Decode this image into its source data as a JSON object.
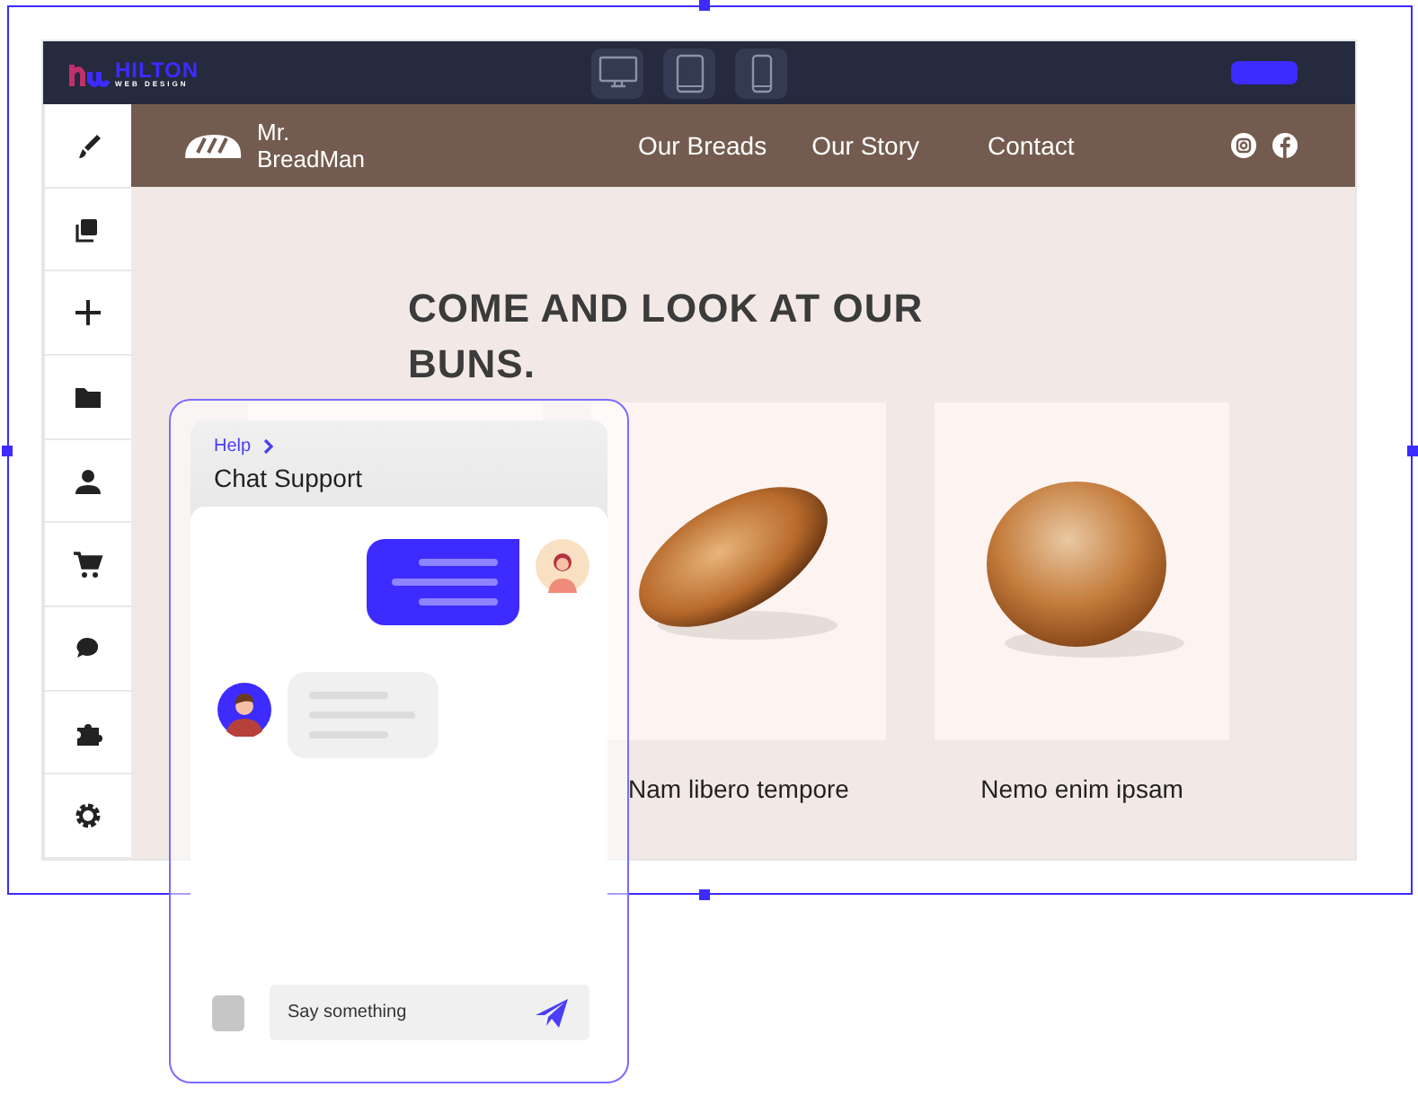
{
  "editor": {
    "logo": {
      "name": "HILTON",
      "tagline": "WEB DESIGN"
    },
    "devices": [
      {
        "kind": "desktop"
      },
      {
        "kind": "tablet"
      },
      {
        "kind": "phone"
      }
    ],
    "sidebar": {
      "items": [
        {
          "kind": "brush"
        },
        {
          "kind": "copy"
        },
        {
          "kind": "plus"
        },
        {
          "kind": "folder"
        },
        {
          "kind": "person"
        },
        {
          "kind": "cart"
        },
        {
          "kind": "chat"
        },
        {
          "kind": "puzzle"
        },
        {
          "kind": "gear"
        }
      ]
    }
  },
  "site": {
    "brand": "Mr. BreadMan",
    "nav": [
      "Our Breads",
      "Our Story",
      "Contact"
    ],
    "heading": "COME AND LOOK AT OUR BUNS.",
    "products": [
      {
        "kind": "blank"
      },
      {
        "kind": "loaf",
        "label": "Nam libero tempore"
      },
      {
        "kind": "round",
        "label": "Nemo enim ipsam"
      }
    ]
  },
  "chat": {
    "breadcrumb": "Help",
    "title": "Chat Support",
    "messages": [
      {
        "kind": "outgoing"
      },
      {
        "kind": "incoming"
      }
    ],
    "input": {
      "placeholder": "Say something"
    }
  }
}
